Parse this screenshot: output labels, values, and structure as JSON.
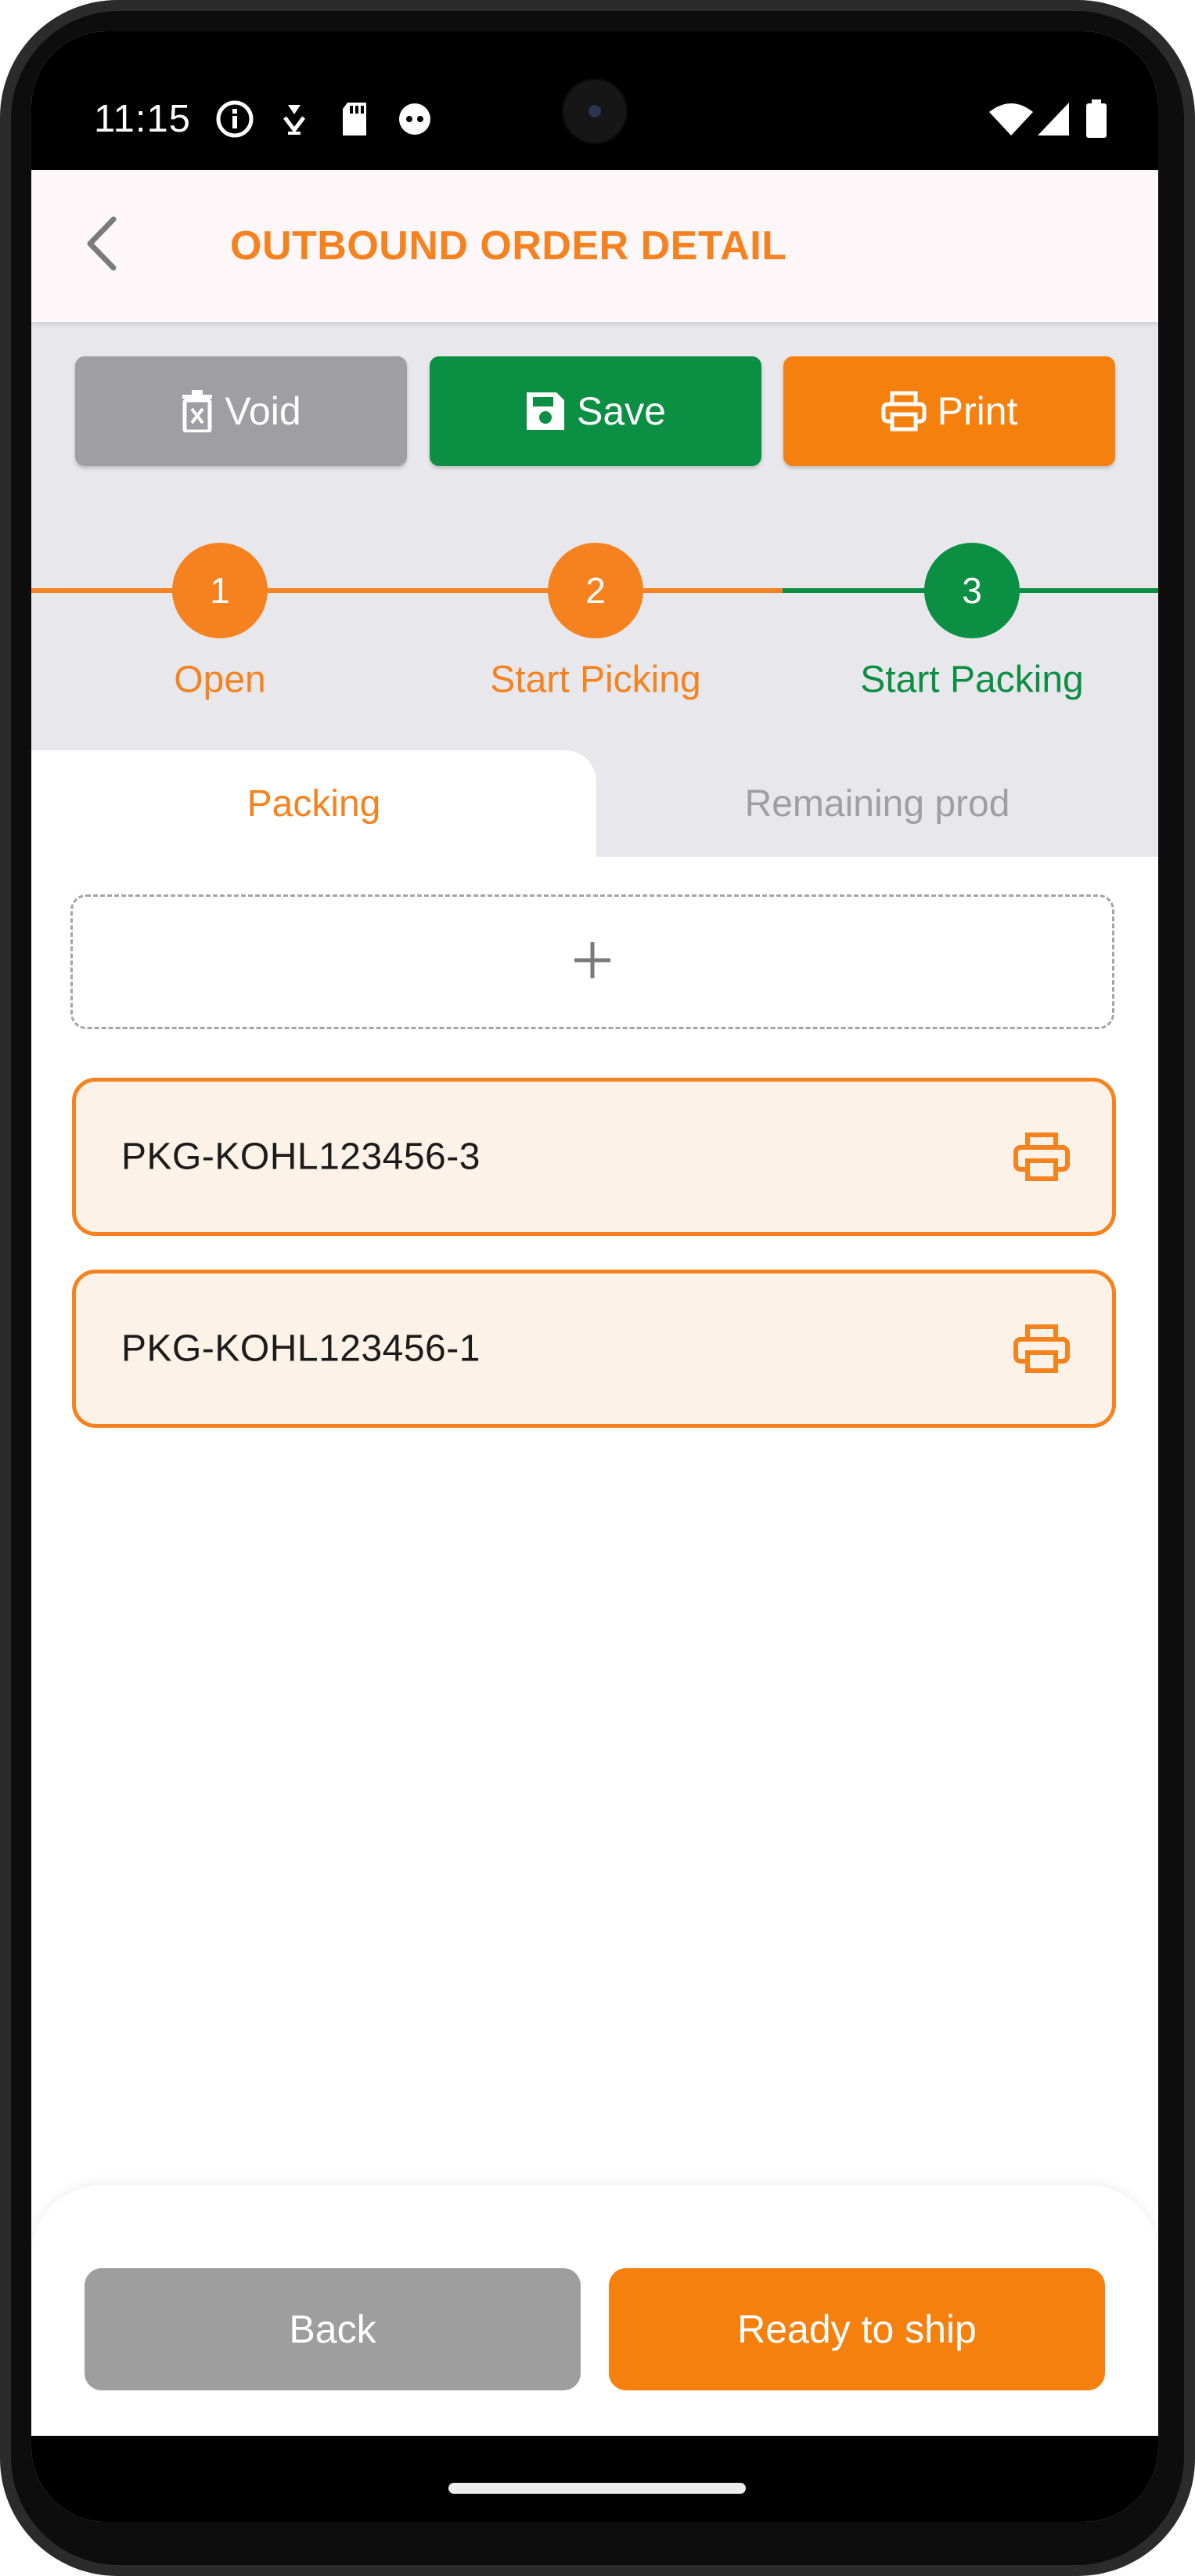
{
  "status_bar": {
    "time": "11:15",
    "left_icons": [
      "info-circle-icon",
      "notification-icon",
      "sd-card-icon",
      "app-face-icon"
    ],
    "right_icons": [
      "wifi-icon",
      "cell-signal-icon",
      "battery-icon"
    ]
  },
  "header": {
    "title": "OUTBOUND ORDER DETAIL",
    "back_icon": "chevron-left-icon"
  },
  "actions": {
    "void_label": "Void",
    "save_label": "Save",
    "print_label": "Print"
  },
  "stepper": {
    "steps": [
      {
        "number": "1",
        "label": "Open"
      },
      {
        "number": "2",
        "label": "Start Picking"
      },
      {
        "number": "3",
        "label": "Start Packing"
      }
    ],
    "current_step": 3
  },
  "tabs": [
    {
      "label": "Packing",
      "active": true
    },
    {
      "label": "Remaining prod",
      "active": false
    }
  ],
  "add_package_icon": "plus-icon",
  "packages": [
    {
      "code": "PKG-KOHL123456-3"
    },
    {
      "code": "PKG-KOHL123456-1"
    }
  ],
  "footer": {
    "back_label": "Back",
    "ship_label": "Ready to ship"
  },
  "colors": {
    "accent_orange": "#f6821f",
    "success_green": "#0b8f43",
    "neutral_grey": "#9e9ea3",
    "card_fill": "#fdf2e7"
  }
}
